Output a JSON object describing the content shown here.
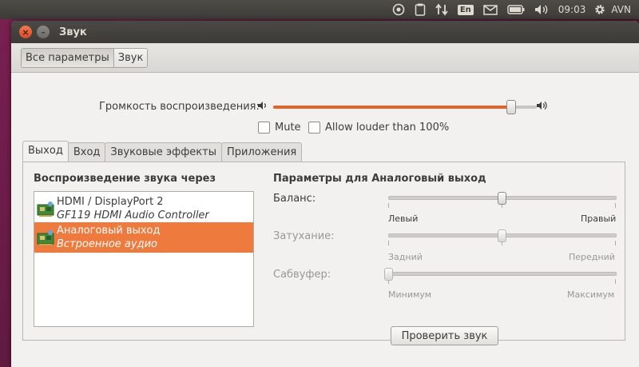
{
  "panel": {
    "keyboard_layout": "En",
    "time": "09:03",
    "user": "AVN",
    "icons": [
      "ubuntu-one-icon",
      "clipboard-icon",
      "network-icon",
      "keyboard-layout-icon",
      "mail-icon",
      "battery-icon",
      "volume-icon",
      "gear-icon"
    ]
  },
  "window": {
    "title": "Звук",
    "close_glyph": "×",
    "minimize_glyph": "–"
  },
  "toolbar": {
    "all_settings": "Все параметры",
    "current": "Звук"
  },
  "volume": {
    "label": "Громкость воспроизведения:",
    "level_fraction": 0.9,
    "mute_label": "Mute",
    "mute_checked": false,
    "louder_label": "Allow louder than 100%",
    "louder_checked": false
  },
  "tabs": [
    "Выход",
    "Вход",
    "Звуковые эффекты",
    "Приложения"
  ],
  "output": {
    "devices_heading": "Воспроизведение звука через",
    "devices": [
      {
        "name": "HDMI / DisplayPort 2",
        "desc": "GF119 HDMI Audio Controller",
        "selected": false
      },
      {
        "name": "Аналоговый выход",
        "desc": "Встроенное аудио",
        "selected": true
      }
    ],
    "settings_heading": "Параметры для Аналоговый выход",
    "balance": {
      "label": "Баланс:",
      "min_label": "Левый",
      "max_label": "Правый",
      "value_fraction": 0.5,
      "enabled": true
    },
    "fade": {
      "label": "Затухание:",
      "min_label": "Задний",
      "max_label": "Передний",
      "value_fraction": 0.5,
      "enabled": false
    },
    "subwoofer": {
      "label": "Сабвуфер:",
      "min_label": "Минимум",
      "max_label": "Максимум",
      "value_fraction": 0.0,
      "enabled": false
    },
    "test_button": "Проверить звук"
  },
  "colors": {
    "accent": "#ef7a3e",
    "panel_bg": "#3d3b37",
    "window_bg": "#f2f1f0"
  }
}
